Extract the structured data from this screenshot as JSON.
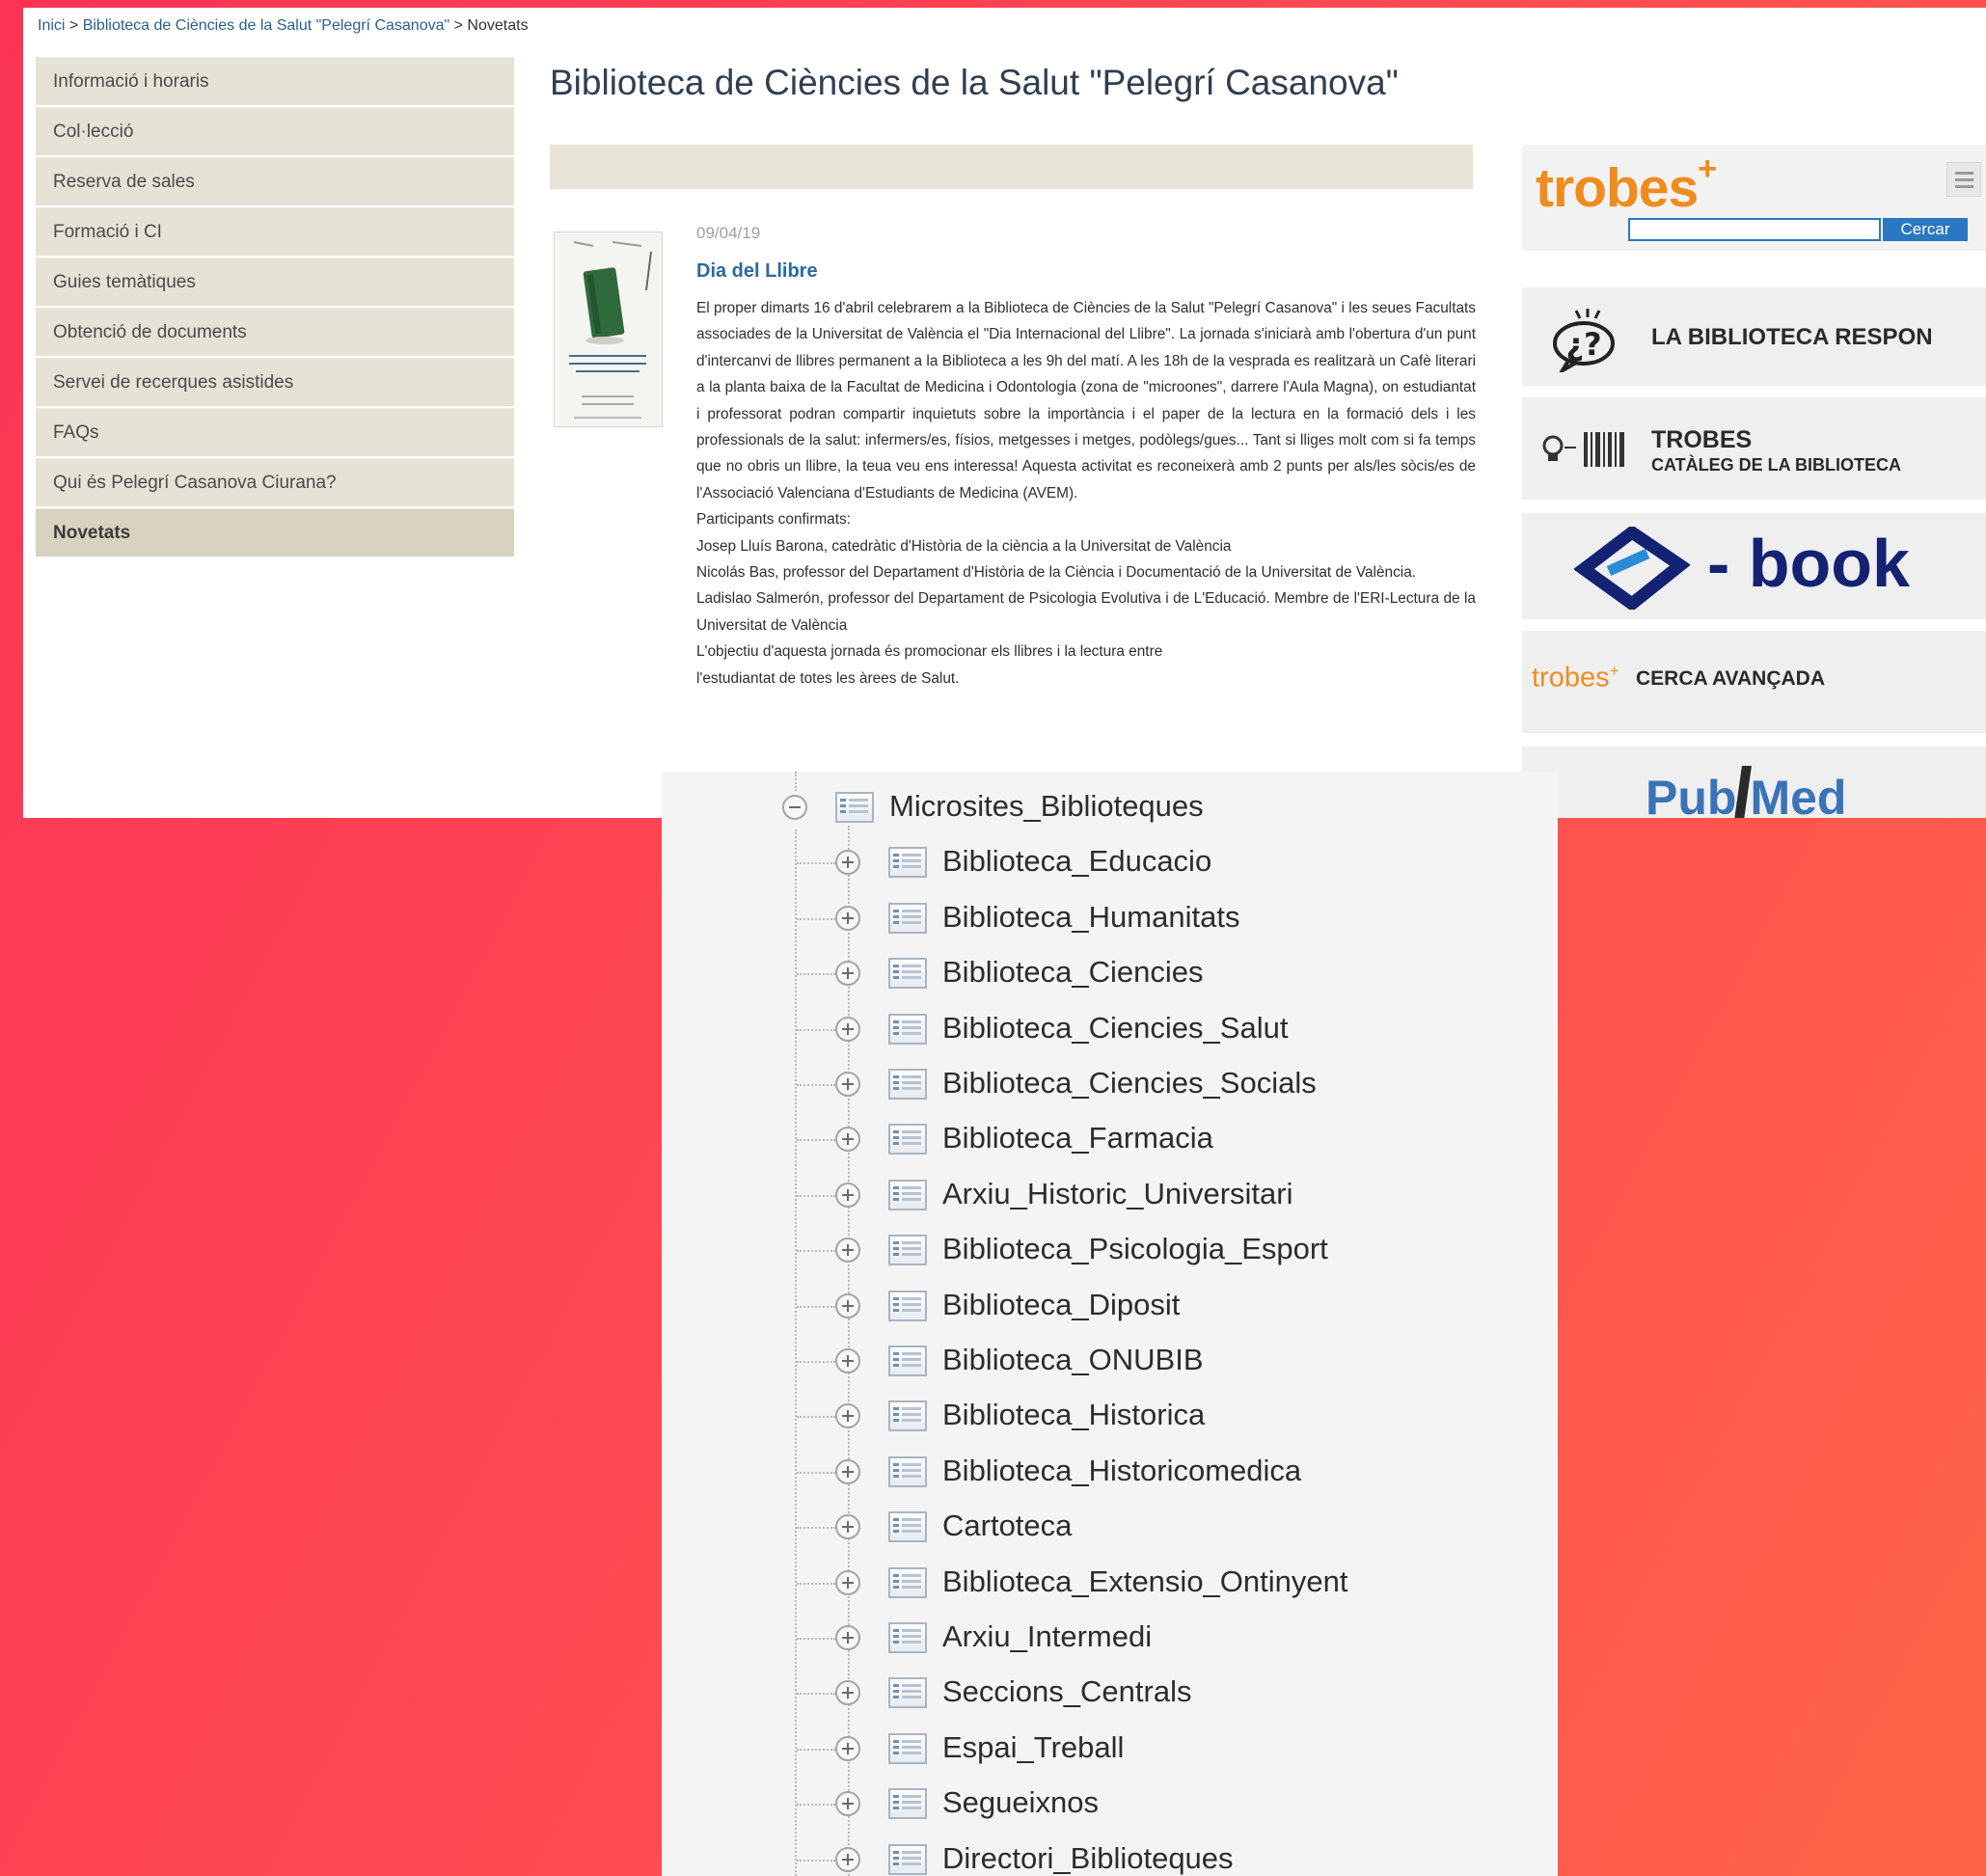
{
  "breadcrumb": {
    "home": "Inici",
    "library": "Biblioteca de Ciències de la Salut \"Pelegrí Casanova\"",
    "current": "Novetats",
    "separator": ">"
  },
  "sidebar": {
    "items": [
      {
        "label": "Informació i horaris"
      },
      {
        "label": "Col·lecció"
      },
      {
        "label": "Reserva de sales"
      },
      {
        "label": "Formació i CI"
      },
      {
        "label": "Guies temàtiques"
      },
      {
        "label": "Obtenció de documents"
      },
      {
        "label": "Servei de recerques asistides"
      },
      {
        "label": "FAQs"
      },
      {
        "label": "Qui és Pelegrí Casanova Ciurana?"
      },
      {
        "label": "Novetats",
        "active": true
      }
    ]
  },
  "main": {
    "title": "Biblioteca de Ciències de la Salut \"Pelegrí Casanova\"",
    "news": {
      "date": "09/04/19",
      "title": "Dia del Llibre",
      "paragraphs": [
        "El proper dimarts 16 d'abril celebrarem a la Biblioteca de Ciències de la Salut \"Pelegrí Casanova\" i les seues Facultats associades de la Universitat de València el \"Dia Internacional del Llibre\". La jornada s'iniciarà amb l'obertura d'un punt d'intercanvi de llibres permanent a la Biblioteca a les 9h del matí. A les 18h de la vesprada es realitzarà un Cafè literari a la planta baixa de la Facultat de Medicina i Odontologia (zona de \"microones\", darrere l'Aula Magna), on estudiantat i professorat podran compartir inquietuts sobre la importància i el paper de la lectura en la formació dels i les professionals de la salut: infermers/es, físios, metgesses i metges, podòlegs/gues... Tant si lliges molt com si fa temps que no obris un llibre, la teua veu ens interessa! Aquesta activitat es reconeixerà amb 2 punts per als/les sòcis/es de l'Associació Valenciana d'Estudiants de Medicina (AVEM).",
        "Participants confirmats:",
        "Josep Lluís Barona, catedràtic d'Història de la ciència a la Universitat de València",
        "Nicolás Bas, professor del Departament d'Història de la Ciència i Documentació de la Universitat de València.",
        "Ladislao Salmerón, professor del Departament de Psicologia Evolutiva i de L'Educació. Membre de l'ERI-Lectura de la Universitat de València",
        "L'objectiu d'aquesta jornada és promocionar els llibres i la lectura entre",
        "l'estudiantat de totes les àrees de Salut."
      ]
    }
  },
  "right_widgets": {
    "trobes": {
      "logo": "trobes",
      "plus": "+",
      "search_button": "Cercar"
    },
    "respon": {
      "label": "LA BIBLIOTECA RESPON"
    },
    "cataleg": {
      "title": "TROBES",
      "subtitle": "CATÀLEG DE LA BIBLIOTECA"
    },
    "ebook": {
      "label": "- book"
    },
    "cerca": {
      "logo": "trobes",
      "plus": "+",
      "label": "CERCA AVANÇADA"
    },
    "pubmed": {
      "label_a": "Pub",
      "label_b": "Med"
    }
  },
  "tree": {
    "root": {
      "label": "Microsites_Biblioteques",
      "expanded": true
    },
    "children": [
      {
        "label": "Biblioteca_Educacio"
      },
      {
        "label": "Biblioteca_Humanitats"
      },
      {
        "label": "Biblioteca_Ciencies"
      },
      {
        "label": "Biblioteca_Ciencies_Salut"
      },
      {
        "label": "Biblioteca_Ciencies_Socials"
      },
      {
        "label": "Biblioteca_Farmacia"
      },
      {
        "label": "Arxiu_Historic_Universitari"
      },
      {
        "label": "Biblioteca_Psicologia_Esport"
      },
      {
        "label": "Biblioteca_Diposit"
      },
      {
        "label": "Biblioteca_ONUBIB"
      },
      {
        "label": "Biblioteca_Historica"
      },
      {
        "label": "Biblioteca_Historicomedica"
      },
      {
        "label": "Cartoteca"
      },
      {
        "label": "Biblioteca_Extensio_Ontinyent"
      },
      {
        "label": "Arxiu_Intermedi"
      },
      {
        "label": "Seccions_Centrals"
      },
      {
        "label": "Espai_Treball"
      },
      {
        "label": "Segueixnos"
      },
      {
        "label": "Directori_Biblioteques"
      }
    ]
  },
  "colors": {
    "background_left": "#fb3456",
    "background_right": "#ff6448",
    "nav_bg": "#e5e2d6",
    "link_blue": "#2b6a9c",
    "trobes_orange": "#f08c1e",
    "ebook_navy": "#142273",
    "pubmed_blue": "#3a73b8"
  }
}
